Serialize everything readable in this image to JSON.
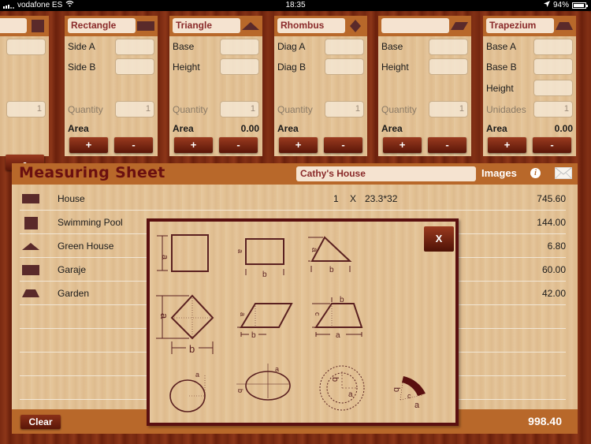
{
  "status_bar": {
    "carrier": "vodafone ES",
    "time": "18:35",
    "battery": "94%"
  },
  "colors": {
    "accent": "#b8682a",
    "title_text": "#8a2a2a",
    "dark_wood": "#7a2a12",
    "button": "#6e1e0c",
    "shape_fill": "#5a2a2a"
  },
  "cards": [
    {
      "title": "",
      "icon": "square-icon",
      "fields": [
        {
          "label": "",
          "value": ""
        }
      ],
      "quantity_label": "",
      "quantity": "1",
      "area_label": "",
      "area": "",
      "plus": "+",
      "minus": "-"
    },
    {
      "title": "Rectangle",
      "icon": "rectangle-icon",
      "fields": [
        {
          "label": "Side A",
          "value": ""
        },
        {
          "label": "Side B",
          "value": ""
        }
      ],
      "quantity_label": "Quantity",
      "quantity": "1",
      "area_label": "Area",
      "area": "",
      "plus": "+",
      "minus": "-"
    },
    {
      "title": "Triangle",
      "icon": "triangle-icon",
      "fields": [
        {
          "label": "Base",
          "value": ""
        },
        {
          "label": "Height",
          "value": ""
        }
      ],
      "quantity_label": "Quantity",
      "quantity": "1",
      "area_label": "Area",
      "area": "0.00",
      "plus": "+",
      "minus": "-"
    },
    {
      "title": "Rhombus",
      "icon": "rhombus-icon",
      "fields": [
        {
          "label": "Diag A",
          "value": ""
        },
        {
          "label": "Diag B",
          "value": ""
        }
      ],
      "quantity_label": "Quantity",
      "quantity": "1",
      "area_label": "Area",
      "area": "",
      "plus": "+",
      "minus": "-"
    },
    {
      "title": "",
      "icon": "parallelogram-icon",
      "fields": [
        {
          "label": "Base",
          "value": ""
        },
        {
          "label": "Height",
          "value": ""
        }
      ],
      "quantity_label": "Quantity",
      "quantity": "1",
      "area_label": "Area",
      "area": "",
      "plus": "+",
      "minus": "-"
    },
    {
      "title": "Trapezium",
      "icon": "trapezium-icon",
      "fields": [
        {
          "label": "Base A",
          "value": ""
        },
        {
          "label": "Base B",
          "value": ""
        },
        {
          "label": "Height",
          "value": ""
        }
      ],
      "quantity_label": "Unidades",
      "quantity": "1",
      "area_label": "Area",
      "area": "0.00",
      "plus": "+",
      "minus": "-"
    }
  ],
  "sheet": {
    "title": "Measuring Sheet",
    "name_value": "Cathy's House",
    "images_label": "Images",
    "info_label": "i",
    "clear_label": "Clear",
    "total": "998.40",
    "rows": [
      {
        "icon": "rectangle-icon",
        "name": "House",
        "qty": "1",
        "x": "X",
        "formula": "23.3*32",
        "value": "745.60"
      },
      {
        "icon": "square-icon",
        "name": "Swimming Pool",
        "qty": "",
        "x": "",
        "formula": "",
        "value": "144.00"
      },
      {
        "icon": "triangle-icon",
        "name": "Green House",
        "qty": "",
        "x": "",
        "formula": "",
        "value": "6.80"
      },
      {
        "icon": "rectangle-icon",
        "name": "Garaje",
        "qty": "",
        "x": "",
        "formula": "",
        "value": "60.00"
      },
      {
        "icon": "trapezium-icon",
        "name": "Garden",
        "qty": "",
        "x": "",
        "formula": "",
        "value": "42.00"
      }
    ]
  },
  "popup": {
    "close_label": "X",
    "figures": [
      {
        "name": "square",
        "labels": [
          "a"
        ]
      },
      {
        "name": "rectangle",
        "labels": [
          "a",
          "b"
        ]
      },
      {
        "name": "triangle",
        "labels": [
          "a",
          "b"
        ]
      },
      {
        "name": "rhombus",
        "labels": [
          "a",
          "b"
        ]
      },
      {
        "name": "parallelogram",
        "labels": [
          "a",
          "b"
        ]
      },
      {
        "name": "trapezium",
        "labels": [
          "b",
          "c",
          "a"
        ]
      },
      {
        "name": "circle",
        "labels": [
          "a"
        ]
      },
      {
        "name": "ellipse",
        "labels": [
          "a",
          "b"
        ]
      },
      {
        "name": "ring",
        "labels": [
          "b",
          "a"
        ]
      },
      {
        "name": "ring-sector",
        "labels": [
          "b",
          "c",
          "a"
        ]
      }
    ]
  }
}
